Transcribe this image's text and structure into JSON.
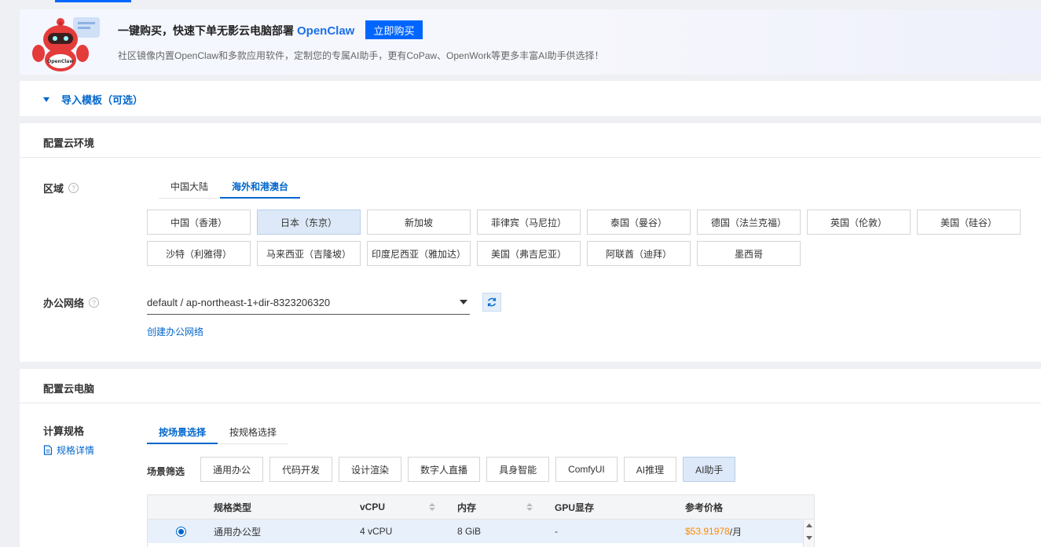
{
  "banner": {
    "title": "一键购买，快速下单无影云电脑部署",
    "brand": "OpenClaw",
    "buy_label": "立即购买",
    "subtitle": "社区镜像内置OpenClaw和多款应用软件，定制您的专属AI助手，更有CoPaw、OpenWork等更多丰富AI助手供选择！",
    "mascot_text": "OpenClaw"
  },
  "import_template": {
    "label": "导入模板（可选）"
  },
  "cloud_env": {
    "title": "配置云环境",
    "region": {
      "label": "区域",
      "tabs": [
        "中国大陆",
        "海外和港澳台"
      ],
      "active_tab": 1,
      "options": [
        "中国（香港）",
        "日本（东京）",
        "新加坡",
        "菲律宾（马尼拉）",
        "泰国（曼谷）",
        "德国（法兰克福）",
        "英国（伦敦）",
        "美国（硅谷）",
        "沙特（利雅得）",
        "马来西亚（吉隆坡）",
        "印度尼西亚（雅加达）",
        "美国（弗吉尼亚）",
        "阿联酋（迪拜）",
        "墨西哥"
      ],
      "selected": 1
    },
    "network": {
      "label": "办公网络",
      "value": "default / ap-northeast-1+dir-8323206320",
      "create_link": "创建办公网络"
    }
  },
  "cloud_pc": {
    "title": "配置云电脑",
    "spec": {
      "label": "计算规格",
      "detail_link": "规格详情",
      "tabs": [
        "按场景选择",
        "按规格选择"
      ],
      "active_tab": 0
    },
    "scene": {
      "label": "场景筛选",
      "options": [
        "通用办公",
        "代码开发",
        "设计渲染",
        "数字人直播",
        "具身智能",
        "ComfyUI",
        "AI推理",
        "AI助手"
      ],
      "selected": 7
    },
    "table": {
      "headers": [
        "规格类型",
        "vCPU",
        "内存",
        "GPU显存",
        "参考价格"
      ],
      "rows": [
        {
          "type": "通用办公型",
          "vcpu": "4 vCPU",
          "memory": "8 GiB",
          "gpu": "-",
          "price": "$53.91978",
          "unit": "/月"
        }
      ]
    }
  },
  "colors": {
    "accent": "#0066ff",
    "link": "#0066cc",
    "price": "#ff8a00",
    "selected_bg": "#dde9f8"
  }
}
